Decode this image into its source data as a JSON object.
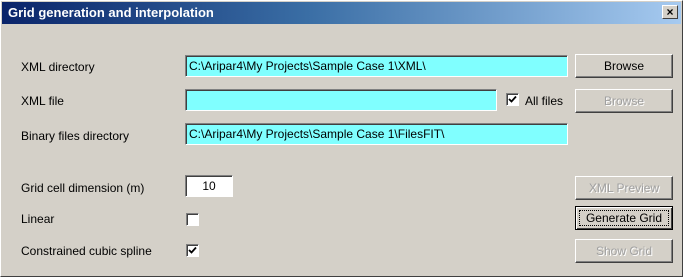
{
  "window": {
    "title": "Grid generation and interpolation",
    "close_glyph": "×"
  },
  "form": {
    "xml_directory": {
      "label": "XML directory",
      "value": "C:\\Aripar4\\My Projects\\Sample Case 1\\XML\\"
    },
    "xml_file": {
      "label": "XML file",
      "value": "",
      "all_files_label": "All files",
      "all_files_checked": true
    },
    "binary_dir": {
      "label": "Binary files directory",
      "value": "C:\\Aripar4\\My Projects\\Sample Case 1\\FilesFIT\\"
    },
    "grid_cell": {
      "label": "Grid cell dimension (m)",
      "value": "10"
    },
    "linear": {
      "label": "Linear",
      "checked": false
    },
    "spline": {
      "label": "Constrained cubic spline",
      "checked": true
    }
  },
  "buttons": {
    "browse_dir": "Browse",
    "browse_file": "Browse",
    "xml_preview": "XML Preview",
    "generate_grid": "Generate Grid",
    "show_grid": "Show Grid"
  },
  "colors": {
    "field_bg": "#80ffff",
    "title_start": "#0a246a",
    "title_end": "#a6caf0",
    "face": "#d4d0c8"
  }
}
